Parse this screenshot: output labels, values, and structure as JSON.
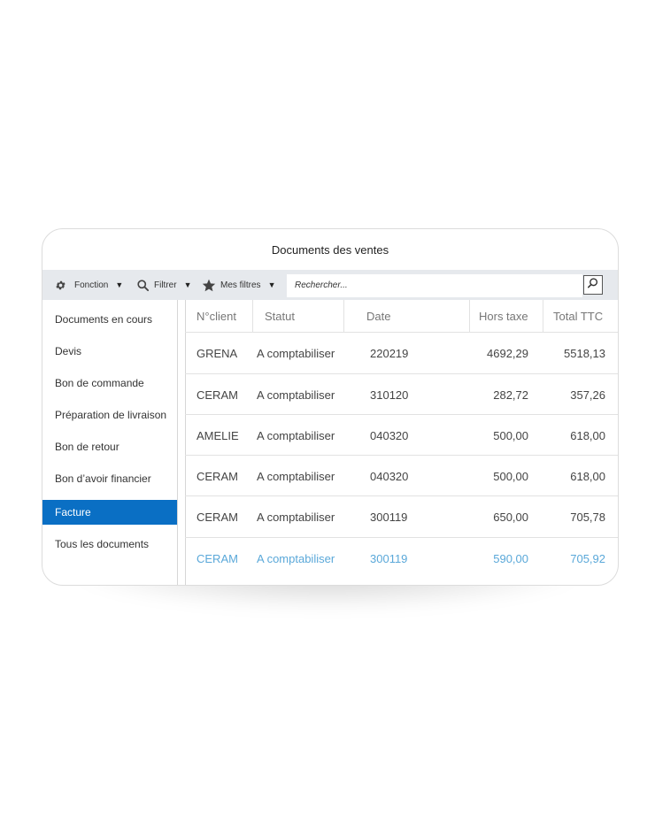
{
  "window": {
    "title": "Documents des ventes"
  },
  "toolbar": {
    "fonction_label": "Fonction",
    "filtrer_label": "Filtrer",
    "mesfiltres_label": "Mes filtres",
    "search_placeholder": "Rechercher...",
    "icons": [
      "gear-icon",
      "search-icon",
      "star-icon",
      "dropdown-caret-icon"
    ]
  },
  "sidebar": {
    "items": [
      {
        "label": "Documents en cours"
      },
      {
        "label": "Devis"
      },
      {
        "label": "Bon de commande"
      },
      {
        "label": "Préparation de livraison"
      },
      {
        "label": "Bon de retour"
      },
      {
        "label": "Bon d’avoir financier"
      },
      {
        "label": "Facture",
        "active": true
      },
      {
        "label": "Tous les documents"
      }
    ]
  },
  "table": {
    "headers": [
      "N°client",
      "Statut",
      "Date",
      "Hors taxe",
      "Total TTC"
    ],
    "rows": [
      [
        "GRENA",
        "A comptabiliser",
        "220219",
        "4692,29",
        "5518,13"
      ],
      [
        "CERAM",
        "A comptabiliser",
        "310120",
        "282,72",
        "357,26"
      ],
      [
        "AMELIE",
        "A comptabiliser",
        "040320",
        "500,00",
        "618,00"
      ],
      [
        "CERAM",
        "A comptabiliser",
        "040320",
        "500,00",
        "618,00"
      ],
      [
        "CERAM",
        "A comptabiliser",
        "300119",
        "650,00",
        "705,78"
      ],
      [
        "CERAM",
        "A comptabiliser",
        "300119",
        "590,00",
        "705,92"
      ]
    ],
    "highlighted_row": 5
  },
  "colors": {
    "accent": "#0a6fc4",
    "highlight_text": "#5aa8d9",
    "toolbar_bg": "#e6e9ed"
  }
}
